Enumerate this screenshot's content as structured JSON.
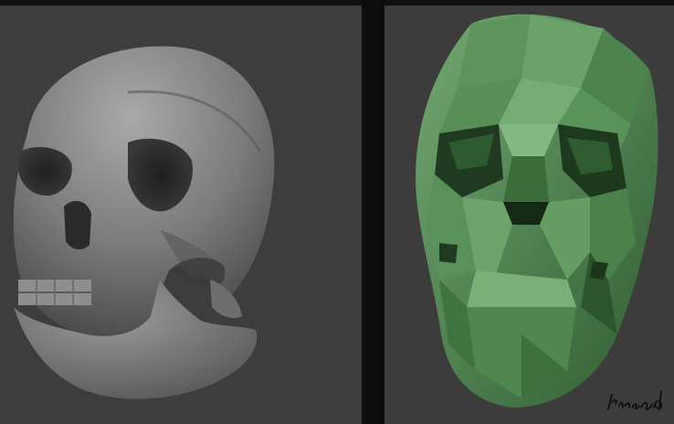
{
  "image": {
    "panels": [
      {
        "name": "smooth-skull",
        "color": "#7a7a7a"
      },
      {
        "name": "lowpoly-skull",
        "color": "#4e8a4f"
      }
    ],
    "signature_text": "Kırşad"
  },
  "colors": {
    "background": "#3d3d3d",
    "divider": "#0d0d0d",
    "gray_skull": "#7d7d7d",
    "green_skull": "#4e8a4f"
  }
}
